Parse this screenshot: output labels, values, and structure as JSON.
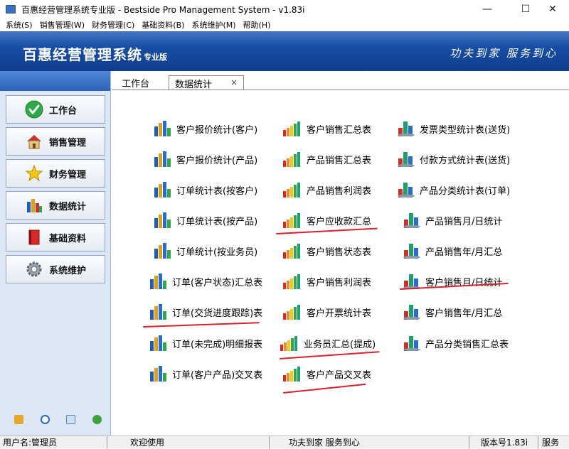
{
  "window": {
    "title": "百惠经营管理系统专业版 - Bestside Pro Management System - v1.83i"
  },
  "menu": [
    {
      "label": "系统(S)"
    },
    {
      "label": "销售管理(W)"
    },
    {
      "label": "财务管理(C)"
    },
    {
      "label": "基础资料(B)"
    },
    {
      "label": "系统维护(M)"
    },
    {
      "label": "帮助(H)"
    }
  ],
  "banner": {
    "brand": "百惠经营管理系统",
    "edition": "专业版",
    "slogan": "功夫到家 服务到心"
  },
  "sidebar": {
    "items": [
      {
        "label": "工作台",
        "icon": "checkmark-icon"
      },
      {
        "label": "销售管理",
        "icon": "house-icon"
      },
      {
        "label": "财务管理",
        "icon": "star-icon"
      },
      {
        "label": "数据统计",
        "icon": "bar-chart-icon"
      },
      {
        "label": "基础资料",
        "icon": "book-icon"
      },
      {
        "label": "系统维护",
        "icon": "gear-icon"
      }
    ],
    "tools": [
      "edit-icon",
      "clock-icon",
      "search-icon",
      "refresh-icon"
    ]
  },
  "tabs": [
    {
      "label": "工作台",
      "active": false
    },
    {
      "label": "数据统计",
      "active": true
    }
  ],
  "reports": {
    "col1": [
      "客户报价统计(客户)",
      "客户报价统计(产品)",
      "订单统计表(按客户)",
      "订单统计表(按产品)",
      "订单统计(按业务员)",
      "订单(客户状态)汇总表",
      "订单(交货进度跟踪)表",
      "订单(未完成)明细报表",
      "订单(客户产品)交叉表"
    ],
    "col2": [
      "客户销售汇总表",
      "产品销售汇总表",
      "产品销售利润表",
      "客户应收款汇总",
      "客户销售状态表",
      "客户销售利润表",
      "客户开票统计表",
      "业务员汇总(提成)",
      "客户产品交叉表"
    ],
    "col3": [
      "发票类型统计表(送货)",
      "付款方式统计表(送货)",
      "产品分类统计表(订单)",
      "产品销售月/日统计",
      "产品销售年/月汇总",
      "客户销售月/日统计",
      "客户销售年/月汇总",
      "产品分类销售汇总表"
    ]
  },
  "statusbar": {
    "user": "用户名:管理员",
    "welcome": "欢迎使用",
    "slogan": "功夫到家 服务到心",
    "version": "版本号1.83i",
    "service": "服务"
  },
  "colors": {
    "banner": "#1d58b5",
    "annotation": "#d8212d"
  }
}
